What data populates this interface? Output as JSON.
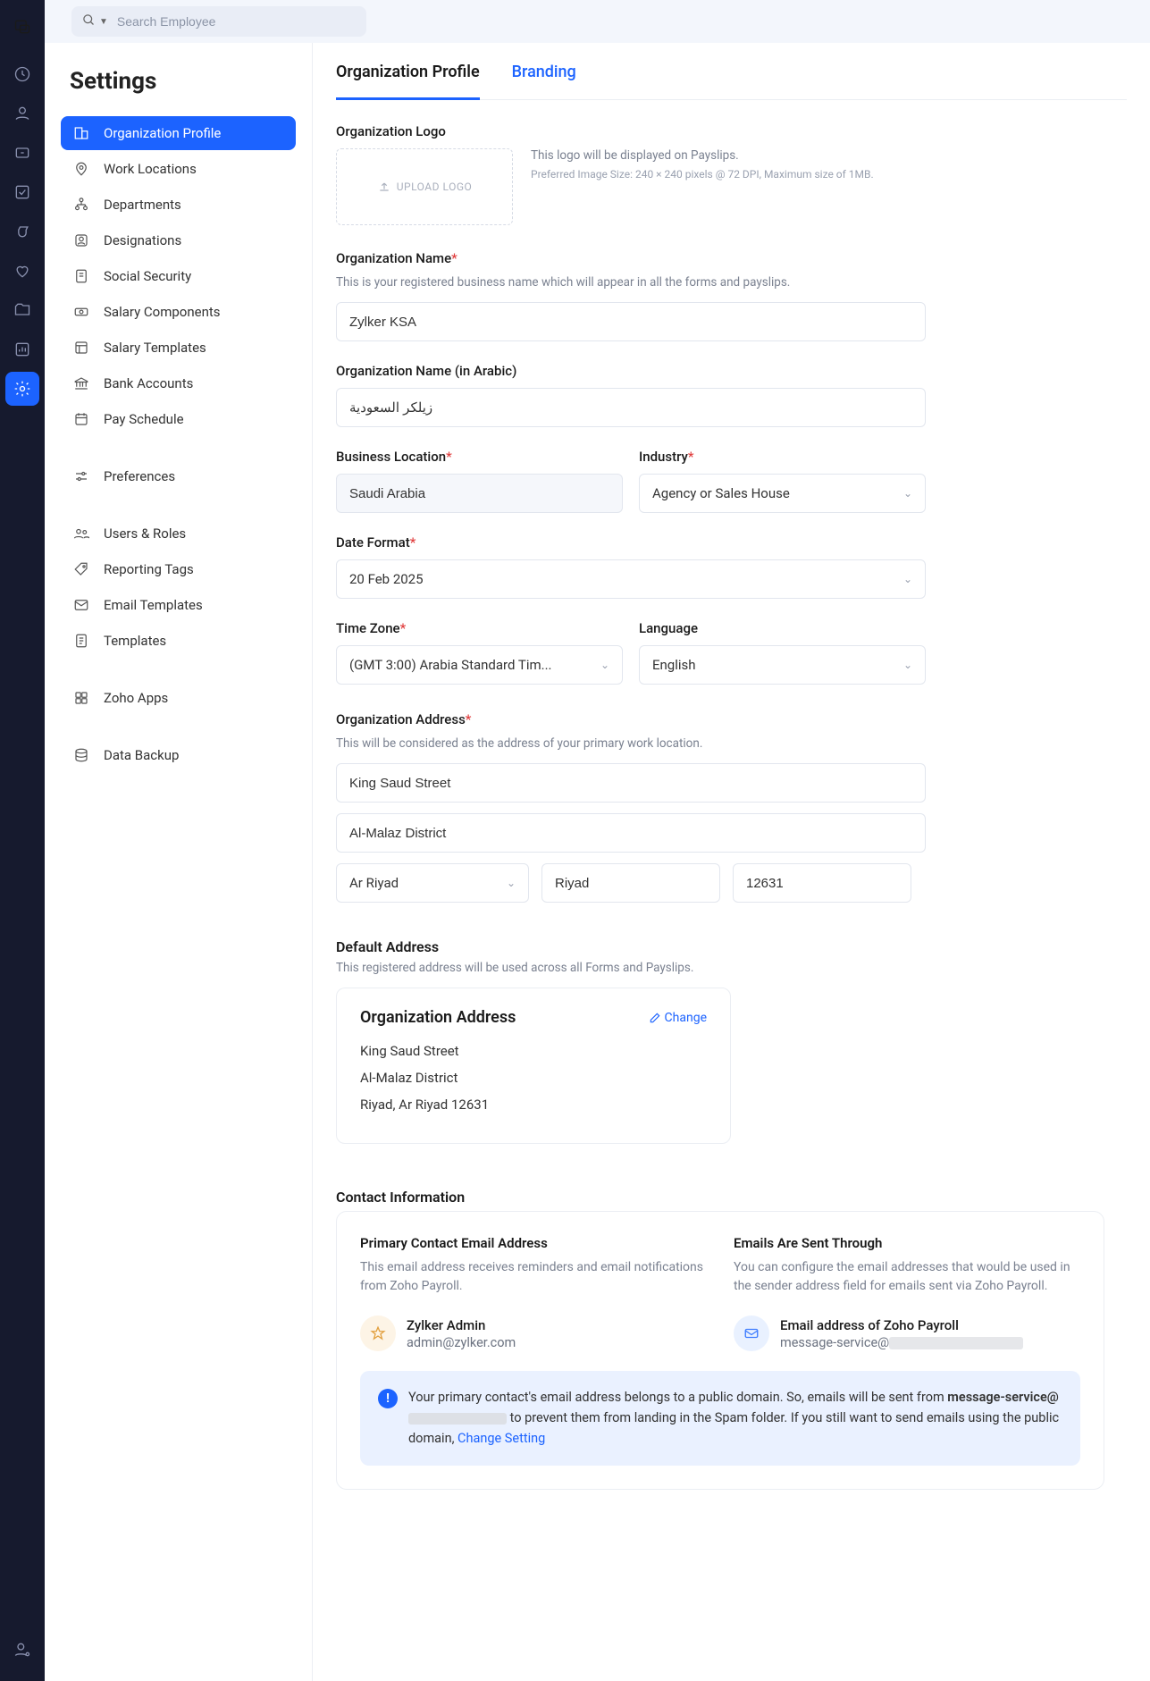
{
  "topbar": {
    "search_placeholder": "Search Employee"
  },
  "settings": {
    "title": "Settings",
    "items": [
      {
        "label": "Organization Profile",
        "active": true
      },
      {
        "label": "Work Locations"
      },
      {
        "label": "Departments"
      },
      {
        "label": "Designations"
      },
      {
        "label": "Social Security"
      },
      {
        "label": "Salary Components"
      },
      {
        "label": "Salary Templates"
      },
      {
        "label": "Bank Accounts"
      },
      {
        "label": "Pay Schedule"
      },
      {
        "gap": true
      },
      {
        "label": "Preferences"
      },
      {
        "gap": true
      },
      {
        "label": "Users & Roles"
      },
      {
        "label": "Reporting Tags"
      },
      {
        "label": "Email Templates"
      },
      {
        "label": "Templates"
      },
      {
        "gap": true
      },
      {
        "label": "Zoho Apps"
      },
      {
        "gap": true
      },
      {
        "label": "Data Backup"
      }
    ]
  },
  "tabs": {
    "profile": "Organization Profile",
    "branding": "Branding"
  },
  "logo": {
    "label": "Organization Logo",
    "upload": "UPLOAD LOGO",
    "info1": "This logo will be displayed on Payslips.",
    "info2": "Preferred Image Size: 240 × 240 pixels @ 72 DPI, Maximum size of 1MB."
  },
  "fields": {
    "org_name_label": "Organization Name",
    "org_name_help": "This is your registered business name which will appear in all the forms and payslips.",
    "org_name_value": "Zylker KSA",
    "org_name_ar_label": "Organization Name (in Arabic)",
    "org_name_ar_value": "زيلكر السعودية",
    "biz_loc_label": "Business Location",
    "biz_loc_value": "Saudi Arabia",
    "industry_label": "Industry",
    "industry_value": "Agency or Sales House",
    "date_label": "Date Format",
    "date_value": "20 Feb 2025",
    "tz_label": "Time Zone",
    "tz_value": "(GMT 3:00) Arabia Standard Tim...",
    "lang_label": "Language",
    "lang_value": "English",
    "addr_section_label": "Organization Address",
    "addr_help": "This will be considered as the address of your primary work location.",
    "addr_line1": "King Saud Street",
    "addr_line2": "Al-Malaz District",
    "addr_state": "Ar Riyad",
    "addr_city": "Riyad",
    "addr_zip": "12631"
  },
  "default_addr": {
    "title": "Default Address",
    "help": "This registered address will be used across all Forms and Payslips.",
    "card_title": "Organization Address",
    "change": "Change",
    "line1": "King Saud Street",
    "line2": "Al-Malaz District",
    "line3": "Riyad, Ar Riyad 12631"
  },
  "contact": {
    "title": "Contact Information",
    "primary_label": "Primary Contact Email Address",
    "primary_help": "This email address receives reminders and email notifications from Zoho Payroll.",
    "primary_name": "Zylker Admin",
    "primary_email": "admin@zylker.com",
    "sent_label": "Emails Are Sent Through",
    "sent_help": "You can configure the email addresses that would be used in the sender address field for emails sent via Zoho Payroll.",
    "sent_name": "Email address of Zoho Payroll",
    "sent_email": "message-service@",
    "alert_pre": "Your primary contact's email address belongs to a public domain. So, emails will be sent from ",
    "alert_bold": "message-service@",
    "alert_post1": " to prevent them from landing in the Spam folder. If you still want to send emails using the public domain, ",
    "alert_link": "Change Setting"
  }
}
